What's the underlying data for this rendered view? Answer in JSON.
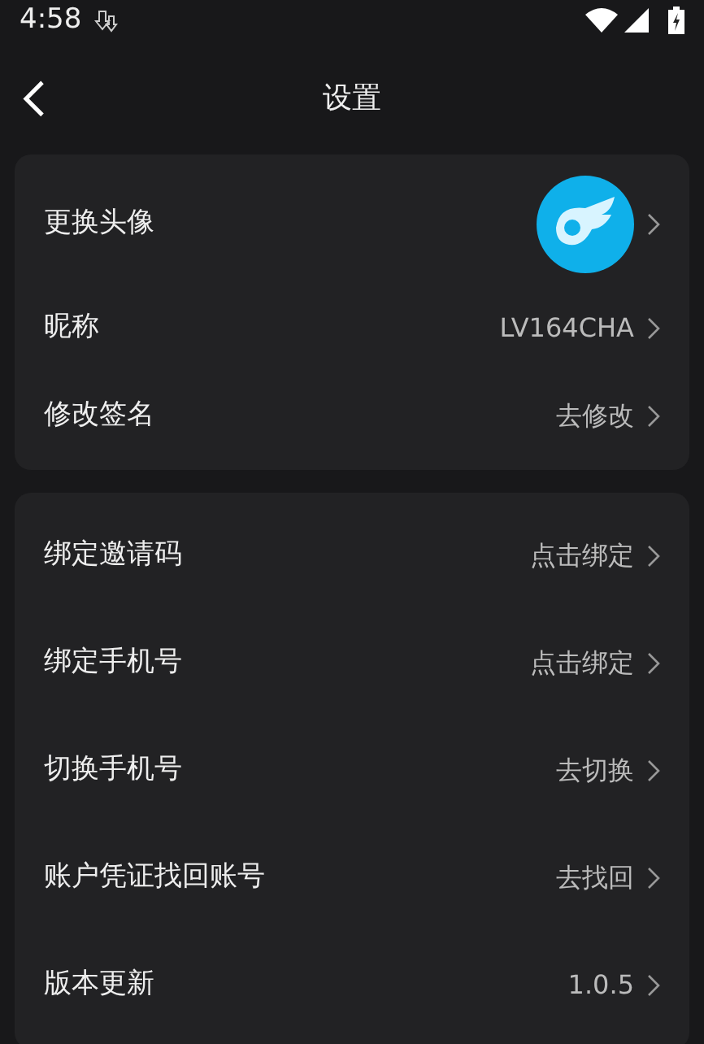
{
  "status_bar": {
    "time": "4:58"
  },
  "header": {
    "title": "设置"
  },
  "groups": [
    {
      "rows": [
        {
          "kind": "avatar",
          "label": "更换头像"
        },
        {
          "kind": "text",
          "label": "昵称",
          "value": "LV164CHA"
        },
        {
          "kind": "text",
          "label": "修改签名",
          "value": "去修改"
        }
      ]
    },
    {
      "rows": [
        {
          "kind": "text",
          "label": "绑定邀请码",
          "value": "点击绑定"
        },
        {
          "kind": "text",
          "label": "绑定手机号",
          "value": "点击绑定"
        },
        {
          "kind": "text",
          "label": "切换手机号",
          "value": "去切换"
        },
        {
          "kind": "text",
          "label": "账户凭证找回账号",
          "value": "去找回"
        },
        {
          "kind": "text",
          "label": "版本更新",
          "value": "1.0.5"
        }
      ]
    }
  ]
}
